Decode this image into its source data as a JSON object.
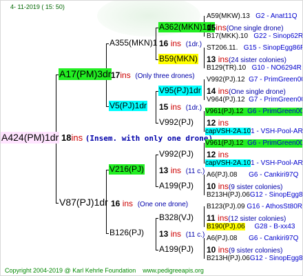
{
  "date": "4- 11-2019 (  15:  50)",
  "footer": {
    "copyright": "Copyright 2004-2019 @ Karl Kehrle Foundation",
    "site": "www.pedigreeapis.org"
  },
  "root": {
    "name": "A424(PM)1dr",
    "count": "18",
    "ins": "ins",
    "note": "(Insem. with only one drone)"
  },
  "sire": {
    "name": "A17(PM)3dr",
    "count": "17",
    "ins": "ins",
    "note": "(Only three drones)",
    "d1": {
      "name": "A355(MKN)1",
      "count": "16",
      "ins": "ins",
      "note": "(1dr.)",
      "a": {
        "name": "A362(MKN)1dr",
        "count": "15",
        "ins": "ins",
        "note": "(One single drone)",
        "p": {
          "name": "A59(MKW).13",
          "code": "G2 - Anat11Q"
        },
        "m": {
          "name": "B17(MKK).10",
          "code": "G22 - Sinop62R"
        }
      },
      "b": {
        "name": "B59(MKN)",
        "count": "13",
        "ins": "ins",
        "note": "(24 sister colonies)",
        "p": {
          "name": "ST206.11.",
          "code": "G15 - SinopEgg86R"
        },
        "m": {
          "name": "B129(TR).10",
          "code": "G10 - NO6294R"
        }
      }
    },
    "d2": {
      "name": "V5(PJ)1dr",
      "count": "15",
      "ins": "ins",
      "note": "(1dr.)",
      "a": {
        "name": "V95(PJ)1dr",
        "count": "14",
        "ins": "ins",
        "note": "(One single drone)",
        "p": {
          "name": "V992(PJ).12",
          "code": "G7 - PrimGreen00"
        },
        "m": {
          "name": "V964(PJ).12",
          "code": "G7 - PrimGreen00"
        }
      },
      "b": {
        "name": "V992(PJ)",
        "count": "12",
        "ins": "ins",
        "p": {
          "name": "V961(PJ).12",
          "code": "G6 - PrimGreen00"
        },
        "m": {
          "name": "capVSH-2A.10",
          "code": "1 - VSH-Pool-AR"
        }
      }
    }
  },
  "dam": {
    "name": "V87(PJ)1dr",
    "count": "16",
    "ins": "ins",
    "note": "(One one drone)",
    "d1": {
      "name": "V216(PJ)",
      "count": "13",
      "ins": "ins",
      "note": "(11 c.)",
      "a": {
        "name": "V992(PJ)",
        "count": "12",
        "ins": "ins",
        "p": {
          "name": "V961(PJ).12",
          "code": "G6 - PrimGreen00"
        },
        "m": {
          "name": "capVSH-2A.10",
          "code": "1 - VSH-Pool-AR"
        }
      },
      "b": {
        "name": "A199(PJ)",
        "count": "10",
        "ins": "ins",
        "note": "(9 sister colonies)",
        "p": {
          "name": "A6(PJ).08",
          "code": "G6 - Cankiri97Q"
        },
        "m": {
          "name": "B213H(PJ).06",
          "code": "G12 - SinopEgg86R"
        }
      }
    },
    "d2": {
      "name": "B126(PJ)",
      "count": "13",
      "ins": "ins",
      "note": "(11 c.)",
      "a": {
        "name": "B328(VJ)",
        "count": "11",
        "ins": "ins",
        "note": "(12 sister colonies)",
        "p": {
          "name": "B123(PJ).09",
          "code": "G16 - AthosSt80R"
        },
        "m": {
          "name": "B190(PJ).06",
          "code": "G28 - B-xx43"
        }
      },
      "b": {
        "name": "A199(PJ)",
        "count": "10",
        "ins": "ins",
        "note": "(9 sister colonies)",
        "p": {
          "name": "A6(PJ).08",
          "code": "G6 - Cankiri97Q"
        },
        "m": {
          "name": "B213H(PJ).06",
          "code": "G12 - SinopEgg86R"
        }
      }
    }
  }
}
